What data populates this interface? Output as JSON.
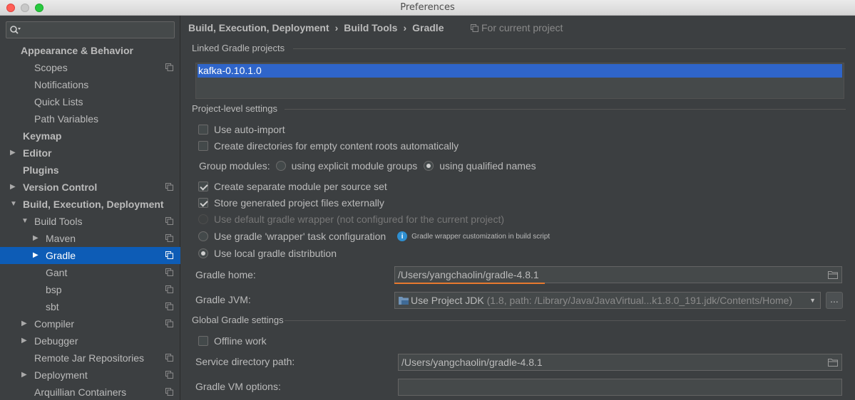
{
  "window": {
    "title": "Preferences"
  },
  "sidebar": {
    "search_placeholder": "",
    "items": [
      {
        "label": "Appearance & Behavior",
        "level": 0,
        "bold": true,
        "arrow": "",
        "copy": false,
        "selected": false
      },
      {
        "label": "Scopes",
        "level": 1,
        "bold": false,
        "arrow": "",
        "copy": true,
        "selected": false
      },
      {
        "label": "Notifications",
        "level": 1,
        "bold": false,
        "arrow": "",
        "copy": false,
        "selected": false
      },
      {
        "label": "Quick Lists",
        "level": 1,
        "bold": false,
        "arrow": "",
        "copy": false,
        "selected": false
      },
      {
        "label": "Path Variables",
        "level": 1,
        "bold": false,
        "arrow": "",
        "copy": false,
        "selected": false
      },
      {
        "label": "Keymap",
        "level": 0,
        "bold": true,
        "arrow": "",
        "copy": false,
        "selected": false
      },
      {
        "label": "Editor",
        "level": 0,
        "bold": true,
        "arrow": "▶",
        "copy": false,
        "selected": false
      },
      {
        "label": "Plugins",
        "level": 0,
        "bold": true,
        "arrow": "",
        "copy": false,
        "selected": false
      },
      {
        "label": "Version Control",
        "level": 0,
        "bold": true,
        "arrow": "▶",
        "copy": true,
        "selected": false
      },
      {
        "label": "Build, Execution, Deployment",
        "level": 0,
        "bold": true,
        "arrow": "▼",
        "copy": false,
        "selected": false
      },
      {
        "label": "Build Tools",
        "level": 1,
        "bold": false,
        "arrow": "▼",
        "copy": true,
        "selected": false
      },
      {
        "label": "Maven",
        "level": 2,
        "bold": false,
        "arrow": "▶",
        "copy": true,
        "selected": false
      },
      {
        "label": "Gradle",
        "level": 2,
        "bold": false,
        "arrow": "▶",
        "copy": true,
        "selected": true
      },
      {
        "label": "Gant",
        "level": 2,
        "bold": false,
        "arrow": "",
        "copy": true,
        "selected": false
      },
      {
        "label": "bsp",
        "level": 2,
        "bold": false,
        "arrow": "",
        "copy": true,
        "selected": false
      },
      {
        "label": "sbt",
        "level": 2,
        "bold": false,
        "arrow": "",
        "copy": true,
        "selected": false
      },
      {
        "label": "Compiler",
        "level": 1,
        "bold": false,
        "arrow": "▶",
        "copy": true,
        "selected": false
      },
      {
        "label": "Debugger",
        "level": 1,
        "bold": false,
        "arrow": "▶",
        "copy": false,
        "selected": false
      },
      {
        "label": "Remote Jar Repositories",
        "level": 1,
        "bold": false,
        "arrow": "",
        "copy": true,
        "selected": false
      },
      {
        "label": "Deployment",
        "level": 1,
        "bold": false,
        "arrow": "▶",
        "copy": true,
        "selected": false
      },
      {
        "label": "Arquillian Containers",
        "level": 1,
        "bold": false,
        "arrow": "",
        "copy": true,
        "selected": false
      }
    ]
  },
  "breadcrumb": {
    "items": [
      "Build, Execution, Deployment",
      "Build Tools",
      "Gradle"
    ],
    "separator": "›",
    "for_current_project": "For current project"
  },
  "linked": {
    "title": "Linked Gradle projects",
    "projects": [
      "kafka-0.10.1.0"
    ]
  },
  "project_settings": {
    "title": "Project-level settings",
    "use_auto_import": "Use auto-import",
    "create_dirs": "Create directories for empty content roots automatically",
    "group_modules_label": "Group modules:",
    "group_explicit": "using explicit module groups",
    "group_qualified": "using qualified names",
    "separate_module": "Create separate module per source set",
    "store_external": "Store generated project files externally",
    "default_wrapper": "Use default gradle wrapper (not configured for the current project)",
    "wrapper_task": "Use gradle 'wrapper' task configuration",
    "wrapper_hint": "Gradle wrapper customization in build script",
    "local_distribution": "Use local gradle distribution",
    "gradle_home_label": "Gradle home:",
    "gradle_home_value": "/Users/yangchaolin/gradle-4.8.1",
    "gradle_jvm_label": "Gradle JVM:",
    "gradle_jvm_value": "Use Project JDK",
    "gradle_jvm_detail": "(1.8, path: /Library/Java/JavaVirtual...k1.8.0_191.jdk/Contents/Home)",
    "ellipsis": "..."
  },
  "global_settings": {
    "title": "Global Gradle settings",
    "offline_work": "Offline work",
    "service_dir_label": "Service directory path:",
    "service_dir_value": "/Users/yangchaolin/gradle-4.8.1",
    "vm_options_label": "Gradle VM options:",
    "vm_options_value": ""
  },
  "colors": {
    "selection": "#0d5cb6",
    "list_selection": "#2f65ca",
    "validation_underline": "#e8792f",
    "info": "#2e8fd1"
  }
}
